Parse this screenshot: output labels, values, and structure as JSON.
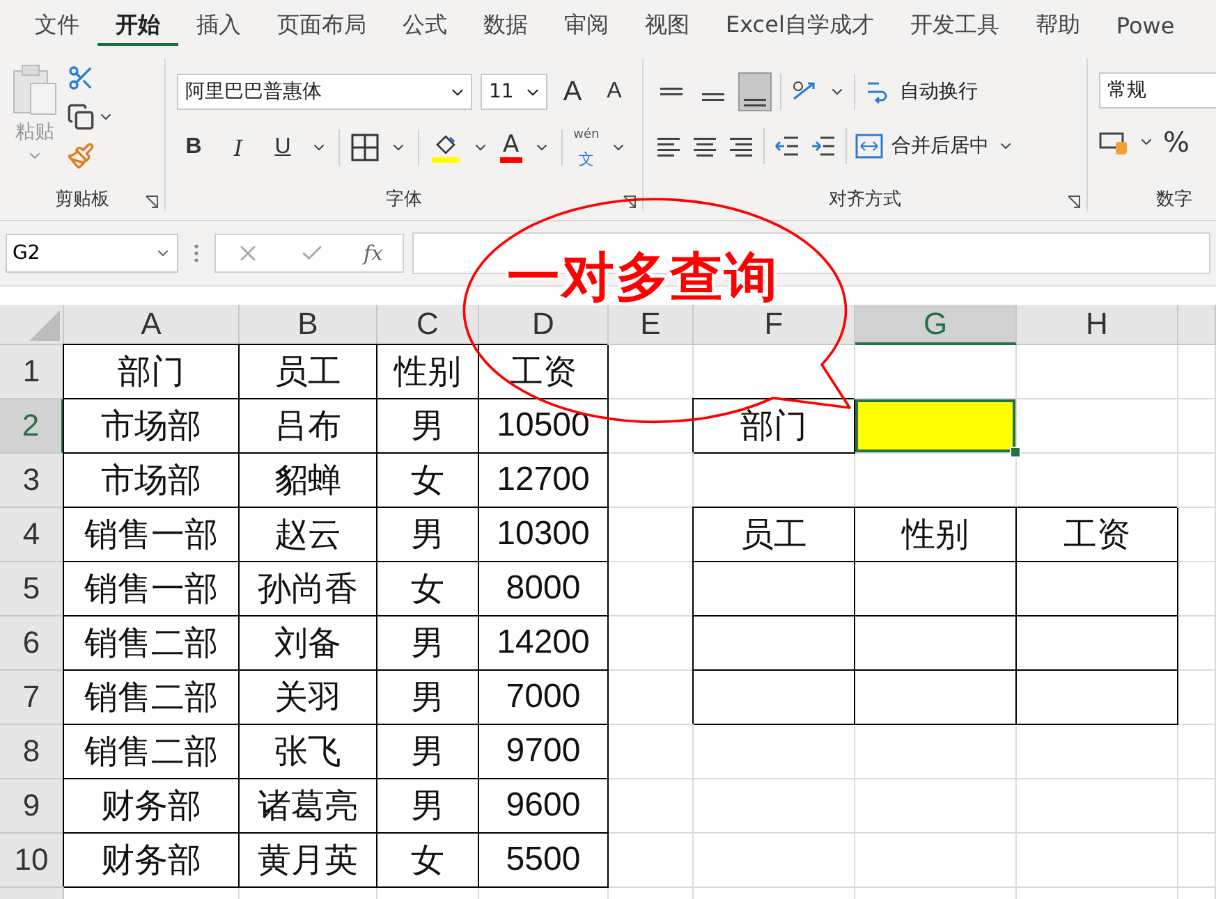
{
  "tabs": [
    {
      "label": "文件",
      "selected": false
    },
    {
      "label": "开始",
      "selected": true
    },
    {
      "label": "插入",
      "selected": false
    },
    {
      "label": "页面布局",
      "selected": false
    },
    {
      "label": "公式",
      "selected": false
    },
    {
      "label": "数据",
      "selected": false
    },
    {
      "label": "审阅",
      "selected": false
    },
    {
      "label": "视图",
      "selected": false
    },
    {
      "label": "Excel自学成才",
      "selected": false
    },
    {
      "label": "开发工具",
      "selected": false
    },
    {
      "label": "帮助",
      "selected": false
    },
    {
      "label": "Powe",
      "selected": false
    }
  ],
  "ribbon": {
    "clipboard": {
      "paste": "粘贴",
      "label": "剪贴板"
    },
    "font": {
      "name": "阿里巴巴普惠体",
      "size": "11",
      "grow": "A",
      "shrink": "A",
      "bold": "B",
      "italic": "I",
      "underline": "U",
      "font_color": "A",
      "phonetic_top": "wén",
      "phonetic_bottom": "文",
      "label": "字体"
    },
    "alignment": {
      "vertical": [
        {
          "selected": false
        },
        {
          "selected": false
        },
        {
          "selected": true
        }
      ],
      "wrap": "自动换行",
      "merge": "合并后居中",
      "label": "对齐方式"
    },
    "number": {
      "format": "常规",
      "percent": "%",
      "label": "数字"
    }
  },
  "formula_bar": {
    "name_box": "G2",
    "function": "fx"
  },
  "sheet": {
    "columns": [
      {
        "label": "A",
        "selected": false
      },
      {
        "label": "B",
        "selected": false
      },
      {
        "label": "C",
        "selected": false
      },
      {
        "label": "D",
        "selected": false
      },
      {
        "label": "E",
        "selected": false
      },
      {
        "label": "F",
        "selected": false
      },
      {
        "label": "G",
        "selected": true
      },
      {
        "label": "H",
        "selected": false
      }
    ],
    "rows": [
      {
        "label": "1",
        "selected": false,
        "cells": [
          {
            "text": "部门",
            "bordered": true,
            "selected": false
          },
          {
            "text": "员工",
            "bordered": true,
            "selected": false
          },
          {
            "text": "性别",
            "bordered": true,
            "selected": false
          },
          {
            "text": "工资",
            "bordered": true,
            "selected": false
          },
          null,
          null,
          null,
          null
        ]
      },
      {
        "label": "2",
        "selected": true,
        "cells": [
          {
            "text": "市场部",
            "bordered": true,
            "selected": false
          },
          {
            "text": "吕布",
            "bordered": true,
            "selected": false
          },
          {
            "text": "男",
            "bordered": true,
            "selected": false
          },
          {
            "text": "10500",
            "bordered": true,
            "selected": false
          },
          null,
          {
            "text": "部门",
            "bordered": true,
            "selected": false
          },
          {
            "bordered": false,
            "selected": true,
            "color": "#ffff00"
          },
          null
        ]
      },
      {
        "label": "3",
        "selected": false,
        "cells": [
          {
            "text": "市场部",
            "bordered": true,
            "selected": false
          },
          {
            "text": "貂蝉",
            "bordered": true,
            "selected": false
          },
          {
            "text": "女",
            "bordered": true,
            "selected": false
          },
          {
            "text": "12700",
            "bordered": true,
            "selected": false
          },
          null,
          null,
          null,
          null
        ]
      },
      {
        "label": "4",
        "selected": false,
        "cells": [
          {
            "text": "销售一部",
            "bordered": true,
            "selected": false
          },
          {
            "text": "赵云",
            "bordered": true,
            "selected": false
          },
          {
            "text": "男",
            "bordered": true,
            "selected": false
          },
          {
            "text": "10300",
            "bordered": true,
            "selected": false
          },
          null,
          {
            "text": "员工",
            "bordered": true,
            "selected": false
          },
          {
            "text": "性别",
            "bordered": true,
            "selected": false
          },
          {
            "text": "工资",
            "bordered": true,
            "selected": false
          }
        ]
      },
      {
        "label": "5",
        "selected": false,
        "cells": [
          {
            "text": "销售一部",
            "bordered": true,
            "selected": false
          },
          {
            "text": "孙尚香",
            "bordered": true,
            "selected": false
          },
          {
            "text": "女",
            "bordered": true,
            "selected": false
          },
          {
            "text": "8000",
            "bordered": true,
            "selected": false
          },
          null,
          {
            "bordered": true,
            "selected": false
          },
          {
            "bordered": true,
            "selected": false
          },
          {
            "bordered": true,
            "selected": false
          }
        ]
      },
      {
        "label": "6",
        "selected": false,
        "cells": [
          {
            "text": "销售二部",
            "bordered": true,
            "selected": false
          },
          {
            "text": "刘备",
            "bordered": true,
            "selected": false
          },
          {
            "text": "男",
            "bordered": true,
            "selected": false
          },
          {
            "text": "14200",
            "bordered": true,
            "selected": false
          },
          null,
          {
            "bordered": true,
            "selected": false
          },
          {
            "bordered": true,
            "selected": false
          },
          {
            "bordered": true,
            "selected": false
          }
        ]
      },
      {
        "label": "7",
        "selected": false,
        "cells": [
          {
            "text": "销售二部",
            "bordered": true,
            "selected": false
          },
          {
            "text": "关羽",
            "bordered": true,
            "selected": false
          },
          {
            "text": "男",
            "bordered": true,
            "selected": false
          },
          {
            "text": "7000",
            "bordered": true,
            "selected": false
          },
          null,
          {
            "bordered": true,
            "selected": false
          },
          {
            "bordered": true,
            "selected": false
          },
          {
            "bordered": true,
            "selected": false
          }
        ]
      },
      {
        "label": "8",
        "selected": false,
        "cells": [
          {
            "text": "销售二部",
            "bordered": true,
            "selected": false
          },
          {
            "text": "张飞",
            "bordered": true,
            "selected": false
          },
          {
            "text": "男",
            "bordered": true,
            "selected": false
          },
          {
            "text": "9700",
            "bordered": true,
            "selected": false
          },
          null,
          null,
          null,
          null
        ]
      },
      {
        "label": "9",
        "selected": false,
        "cells": [
          {
            "text": "财务部",
            "bordered": true,
            "selected": false
          },
          {
            "text": "诸葛亮",
            "bordered": true,
            "selected": false
          },
          {
            "text": "男",
            "bordered": true,
            "selected": false
          },
          {
            "text": "9600",
            "bordered": true,
            "selected": false
          },
          null,
          null,
          null,
          null
        ]
      },
      {
        "label": "10",
        "selected": false,
        "cells": [
          {
            "text": "财务部",
            "bordered": true,
            "selected": false
          },
          {
            "text": "黄月英",
            "bordered": true,
            "selected": false
          },
          {
            "text": "女",
            "bordered": true,
            "selected": false
          },
          {
            "text": "5500",
            "bordered": true,
            "selected": false
          },
          null,
          null,
          null,
          null
        ]
      }
    ]
  },
  "callout": {
    "text": "一对多查询"
  }
}
